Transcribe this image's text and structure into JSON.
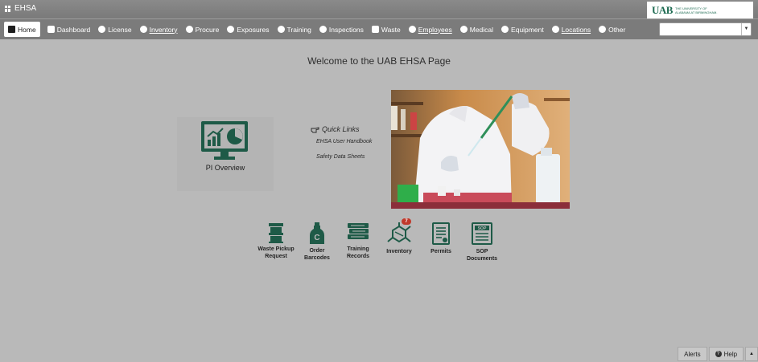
{
  "app": {
    "title": "EHSA"
  },
  "logo": {
    "mark": "UAB",
    "line1": "THE UNIVERSITY OF",
    "line2": "ALABAMA AT BIRMINGHAM."
  },
  "nav": {
    "home": "Home",
    "dashboard": "Dashboard",
    "license": "License",
    "inventory": "Inventory",
    "procure": "Procure",
    "exposures": "Exposures",
    "training": "Training",
    "inspections": "Inspections",
    "waste": "Waste",
    "employees": "Employees",
    "medical": "Medical",
    "equipment": "Equipment",
    "locations": "Locations",
    "other": "Other"
  },
  "search": {
    "value": ""
  },
  "welcome": "Welcome to the UAB EHSA Page",
  "pi_overview": {
    "label": "PI Overview"
  },
  "quick_links": {
    "title": "Quick Links",
    "handbook": "EHSA User Handbook",
    "sds": "Safety Data Sheets"
  },
  "tiles": {
    "waste": {
      "line1": "Waste Pickup",
      "line2": "Request"
    },
    "barcodes": {
      "line1": "Order",
      "line2": "Barcodes"
    },
    "training": {
      "line1": "Training",
      "line2": "Records"
    },
    "inventory": {
      "line1": "Inventory",
      "badge": "7"
    },
    "permits": {
      "line1": "Permits"
    },
    "sop": {
      "line1": "SOP",
      "line2": "Documents",
      "icon_text": "SOP"
    }
  },
  "footer": {
    "alerts": "Alerts",
    "help": "Help",
    "collapse": "▲"
  },
  "colors": {
    "brand_green": "#1e5a47",
    "nav_bg": "#7b7b7b",
    "page_bg": "#b9b9b9",
    "badge": "#c0392b"
  },
  "icons": {
    "app": "grid-icon",
    "pi": "monitor-chart-icon",
    "quick_links": "pointing-hand-icon",
    "waste": "barrel-icon",
    "barcodes": "bottle-icon",
    "training": "books-icon",
    "inventory": "molecule-icon",
    "permits": "document-icon",
    "sop": "sop-document-icon"
  }
}
